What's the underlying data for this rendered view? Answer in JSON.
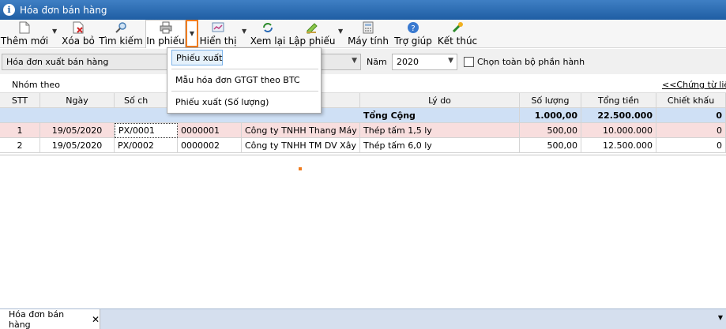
{
  "window": {
    "title": "Hóa đơn bán hàng"
  },
  "toolbar": {
    "new_label": "Thêm mới",
    "delete_label": "Xóa bỏ",
    "search_label": "Tìm kiếm",
    "print_label": "In phiếu",
    "display_label": "Hiển thị",
    "review_label": "Xem lại",
    "create_label": "Lập phiếu",
    "calc_label": "Máy tính",
    "help_label": "Trợ giúp",
    "exit_label": "Kết thúc"
  },
  "filter": {
    "doc_type": "Hóa đơn xuất bán hàng",
    "year_label": "Năm",
    "year_value": "2020",
    "select_all_label": "Chọn toàn bộ phần hành"
  },
  "group": {
    "group_by_label": "Nhóm theo",
    "vouchers_link": "<<Chứng từ liên k"
  },
  "table": {
    "headers": [
      "STT",
      "Ngày",
      "Số ch",
      "",
      "",
      "Lý do",
      "Số lượng",
      "Tổng tiền",
      "Chiết khấu"
    ],
    "total": {
      "label": "Tổng Cộng",
      "qty": "1.000,00",
      "amount": "22.500.000",
      "discount": "0"
    },
    "rows": [
      {
        "stt": "1",
        "date": "19/05/2020",
        "voucher": "PX/0001",
        "invoice": "0000001",
        "company": "Công ty TNHH Thang Máy An",
        "reason": "Thép tấm 1,5 ly",
        "qty": "500,00",
        "amount": "10.000.000",
        "discount": "0"
      },
      {
        "stt": "2",
        "date": "19/05/2020",
        "voucher": "PX/0002",
        "invoice": "0000002",
        "company": "Công ty TNHH TM DV Xây Dự",
        "reason": "Thép tấm 6,0 ly",
        "qty": "500,00",
        "amount": "12.500.000",
        "discount": "0"
      }
    ]
  },
  "print_menu": {
    "items": [
      "Phiếu xuất",
      "Mẫu hóa đơn GTGT theo BTC",
      "Phiếu xuất (Số lượng)"
    ]
  },
  "tabs": {
    "items": [
      "Hóa đơn bán hàng"
    ]
  },
  "colors": {
    "title_bar": "#1f5ea3",
    "total_row": "#cfe0f5",
    "selected_row": "#f8dede",
    "highlight": "#f07c1f"
  }
}
